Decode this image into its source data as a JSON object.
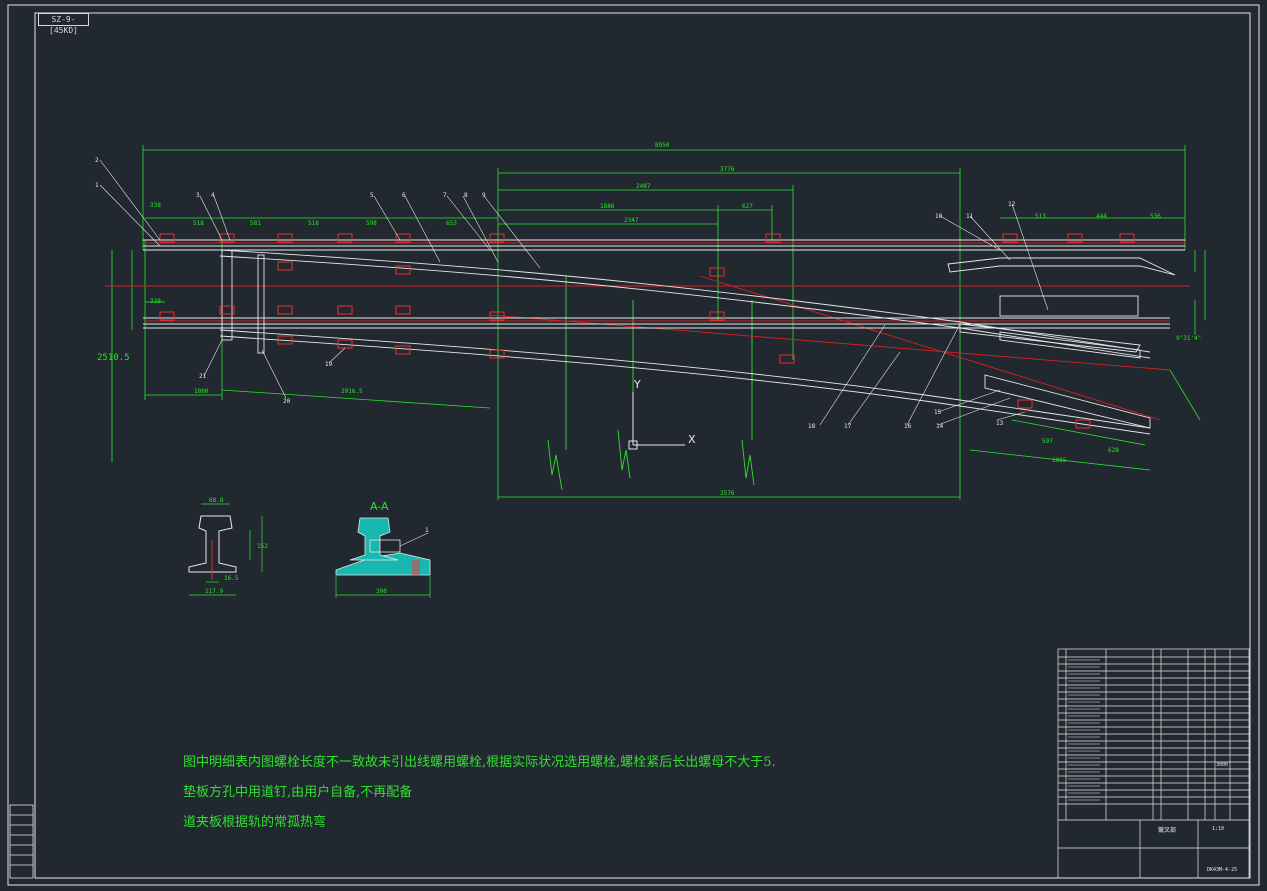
{
  "drawing": {
    "sheet_tag": "SZ-9-[45KD]",
    "colors": {
      "background": "#212830",
      "outline": "#e8e8e8",
      "dimension": "#2fe02f",
      "centerline": "#e02020",
      "accent": "#ff3030",
      "section_fill": "#18b8b0"
    },
    "notes": [
      "图中明细表内图螺栓长度不一致故未引出线螺用螺栓,根据实际状况选用螺栓,螺栓紧后长出螺母不大于5.",
      "垫板方孔中用道钉,由用户自备,不再配备",
      "道夹板根据轨的常孤热弯"
    ],
    "dimensions": {
      "overall": "8950",
      "upper_1": "3776",
      "upper_2": "2487",
      "upper_3": "1886",
      "upper_4": "2347",
      "upper_5": "627",
      "left_row": [
        "338",
        "518",
        "581",
        "518",
        "598",
        "653"
      ],
      "right_row": [
        "513",
        "444",
        "536"
      ],
      "lower_left": "338",
      "lower_offset": "2916.5",
      "base": "1800",
      "bottom": "3576",
      "gauge": "2510.5",
      "right_lower_1": "597",
      "right_lower_2": "1865",
      "right_lower_3": "628",
      "angle": "9°31'4\""
    },
    "callouts": [
      "1",
      "2",
      "3",
      "4",
      "5",
      "6",
      "7",
      "8",
      "9",
      "10",
      "11",
      "12",
      "13",
      "14",
      "15",
      "16",
      "17",
      "18",
      "19",
      "20",
      "21"
    ],
    "rail_section": {
      "head": "68.8",
      "height": "152",
      "web": "16.5",
      "base": "117.9"
    },
    "section_aa": {
      "title": "A-A",
      "width": "300",
      "callout": "1"
    },
    "ucs_labels": {
      "x": "X",
      "y": "Y"
    },
    "title_block": {
      "part_name": "辙叉部",
      "scale": "1:10",
      "drawing_no": "DK43M-4-25",
      "weight": "3000"
    }
  }
}
